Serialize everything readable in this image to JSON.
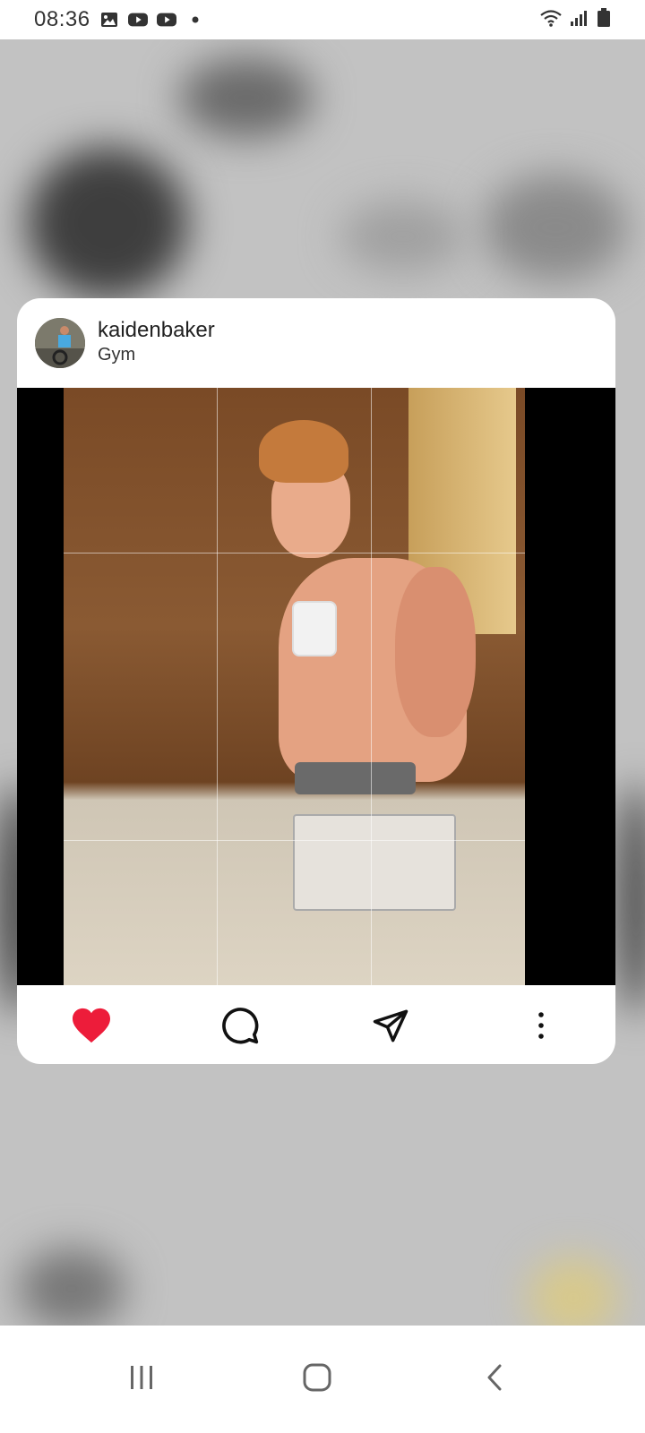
{
  "status_bar": {
    "time": "08:36",
    "notification_icons": [
      "gallery-icon",
      "youtube-icon",
      "youtube-icon",
      "dot-icon"
    ],
    "system_icons": [
      "wifi-icon",
      "signal-icon",
      "battery-icon"
    ]
  },
  "post": {
    "username": "kaidenbaker",
    "location": "Gym",
    "image_description_icon": "photo",
    "actions": [
      "like-icon",
      "comment-icon",
      "share-icon",
      "more-options-icon"
    ],
    "liked": true,
    "like_color": "#ed1c3a"
  },
  "nav_bar": {
    "buttons": [
      "recent-apps-icon",
      "home-icon",
      "back-icon"
    ]
  },
  "colors": {
    "background": "#c4c4c4",
    "card": "#ffffff",
    "media_letterbox": "#000000"
  }
}
